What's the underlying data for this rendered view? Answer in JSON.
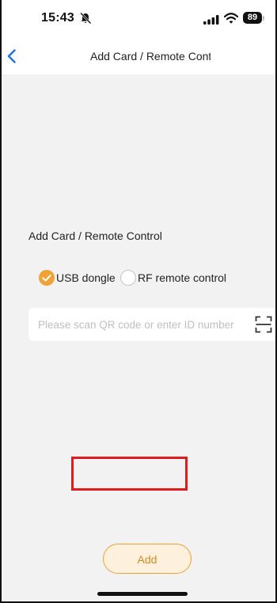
{
  "status_bar": {
    "time": "15:43",
    "battery": "89",
    "icons": [
      "bell-off-icon",
      "signal-icon",
      "wifi-icon",
      "battery-icon"
    ]
  },
  "nav": {
    "title": "Add Card / Remote Contr",
    "back_icon": "chevron-left-icon"
  },
  "form": {
    "section_title": "Add Card / Remote Control",
    "options": [
      {
        "label": "USB dongle",
        "checked": true
      },
      {
        "label": "RF remote control",
        "checked": false
      }
    ],
    "id_input": {
      "placeholder": "Please scan QR code or enter ID number",
      "value": ""
    },
    "scan_icon": "scan-qr-icon"
  },
  "add_button": {
    "label": "Add"
  },
  "colors": {
    "accent": "#f0a234",
    "accent_text": "#d98a1e",
    "button_bg": "#fdf1dd",
    "highlight": "#e01b1b",
    "background": "#f2f2f2",
    "link_blue": "#1a73e8"
  }
}
